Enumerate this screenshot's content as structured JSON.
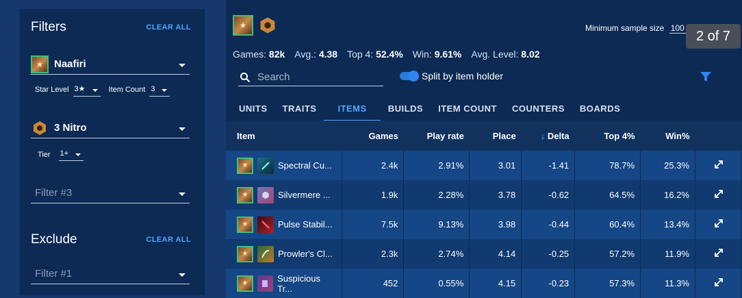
{
  "filters": {
    "title": "Filters",
    "clear_all": "CLEAR ALL",
    "unit": {
      "name": "Naafiri",
      "icon": "naafiri-portrait-icon"
    },
    "star_level": {
      "label": "Star Level",
      "value": "3★"
    },
    "item_count": {
      "label": "Item Count",
      "value": "3"
    },
    "trait": {
      "name": "3 Nitro",
      "icon": "nitro-trait-icon"
    },
    "tier": {
      "label": "Tier",
      "value": "1+"
    },
    "filter3_placeholder": "Filter #3"
  },
  "exclude": {
    "title": "Exclude",
    "clear_all": "CLEAR ALL",
    "filter1_placeholder": "Filter #1"
  },
  "main": {
    "min_sample": {
      "label": "Minimum sample size",
      "value": "100"
    },
    "tooltip": "2 of 7",
    "stats": {
      "games_label": "Games:",
      "games_value": "82k",
      "avg_label": "Avg.:",
      "avg_value": "4.38",
      "top4_label": "Top 4:",
      "top4_value": "52.4%",
      "win_label": "Win:",
      "win_value": "9.61%",
      "level_label": "Avg. Level:",
      "level_value": "8.02"
    },
    "search_placeholder": "Search",
    "split_toggle": "Split by item holder",
    "tabs": [
      "UNITS",
      "TRAITS",
      "ITEMS",
      "BUILDS",
      "ITEM COUNT",
      "COUNTERS",
      "BOARDS"
    ],
    "active_tab": "ITEMS",
    "table": {
      "headers": [
        "Item",
        "Games",
        "Play rate",
        "Place",
        "Delta",
        "Top 4%",
        "Win%"
      ],
      "sort_indicator": "↓",
      "rows": [
        {
          "item": "Spectral Cu...",
          "games": "2.4k",
          "play_rate": "2.91%",
          "place": "3.01",
          "delta": "-1.41",
          "top4": "78.7%",
          "win": "25.3%"
        },
        {
          "item": "Silvermere ...",
          "games": "1.9k",
          "play_rate": "2.28%",
          "place": "3.78",
          "delta": "-0.62",
          "top4": "64.5%",
          "win": "16.2%"
        },
        {
          "item": "Pulse Stabil...",
          "games": "7.5k",
          "play_rate": "9.13%",
          "place": "3.98",
          "delta": "-0.44",
          "top4": "60.4%",
          "win": "13.4%"
        },
        {
          "item": "Prowler's Cl...",
          "games": "2.3k",
          "play_rate": "2.74%",
          "place": "4.14",
          "delta": "-0.25",
          "top4": "57.2%",
          "win": "11.9%"
        },
        {
          "item": "Suspicious Tr...",
          "games": "452",
          "play_rate": "0.55%",
          "place": "4.15",
          "delta": "-0.23",
          "top4": "57.3%",
          "win": "11.3%"
        }
      ]
    }
  },
  "colors": {
    "accent": "#4fa4ff",
    "panel": "#0c2a54",
    "row_a": "#154685",
    "row_b": "#103a70"
  }
}
